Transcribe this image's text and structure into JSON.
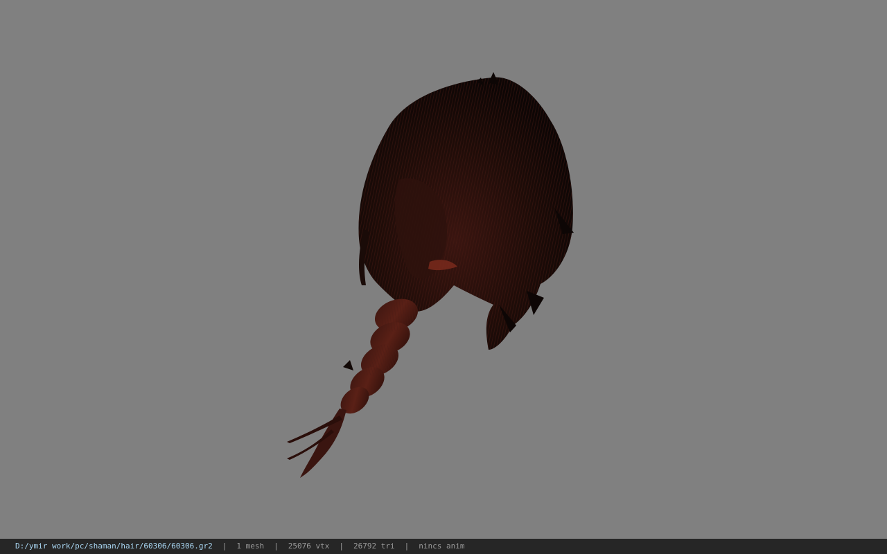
{
  "viewport": {
    "background_color": "#808080",
    "model_icon": "hair-mesh-render",
    "hair_dark_color": "#120907",
    "hair_highlight_color": "#5a2016"
  },
  "status_bar": {
    "file_path": "D:/ymir work/pc/shaman/hair/60306/60306.gr2",
    "mesh_count": "1 mesh",
    "vertex_count": "25076 vtx",
    "triangle_count": "26792 tri",
    "animation": "nincs anim",
    "separator": "|",
    "path_color": "#a9d6f2",
    "background_color": "#262626"
  }
}
